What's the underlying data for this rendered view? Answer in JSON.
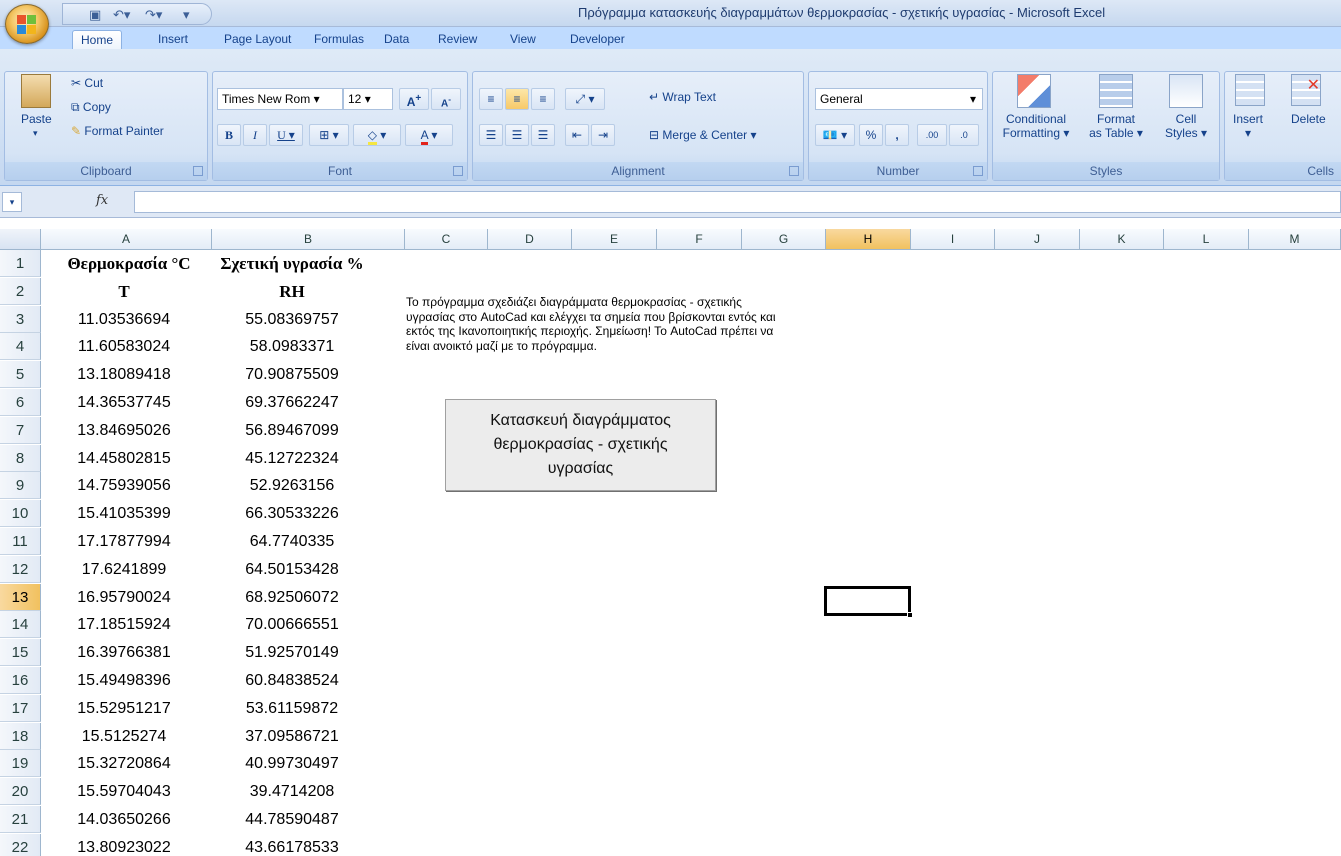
{
  "window": {
    "title": "Πρόγραμμα κατασκευής διαγραμμάτων θερμοκρασίας - σχετικής υγρασίας - Microsoft Excel"
  },
  "tabs": [
    "Home",
    "Insert",
    "Page Layout",
    "Formulas",
    "Data",
    "Review",
    "View",
    "Developer"
  ],
  "ribbon": {
    "clipboard": {
      "label": "Clipboard",
      "paste": "Paste",
      "cut": "Cut",
      "copy": "Copy",
      "format_painter": "Format Painter"
    },
    "font": {
      "label": "Font",
      "font_name": "Times New Rom",
      "font_size": "12"
    },
    "alignment": {
      "label": "Alignment",
      "wrap_text": "Wrap Text",
      "merge_center": "Merge & Center"
    },
    "number": {
      "label": "Number",
      "format": "General",
      "percent": "%",
      "comma": ",",
      "inc_dec": ".00",
      "dec_dec": ".0"
    },
    "styles": {
      "label": "Styles",
      "conditional": "Conditional",
      "conditional2": "Formatting",
      "format_table": "Format",
      "format_table2": "as Table",
      "cell_styles": "Cell",
      "cell_styles2": "Styles"
    },
    "cells": {
      "label": "Cells",
      "insert": "Insert",
      "delete": "Delete"
    }
  },
  "formula_bar": {
    "fx": "fx",
    "value": ""
  },
  "columns": [
    "A",
    "B",
    "C",
    "D",
    "E",
    "F",
    "G",
    "H",
    "I",
    "J",
    "K",
    "L",
    "M"
  ],
  "selected_column": "H",
  "selected_row": "13",
  "sheet": {
    "header_row1": {
      "A": "Θερμοκρασία °C",
      "B": "Σχετική υγρασία %"
    },
    "header_row2": {
      "A": "T",
      "B": "RH"
    },
    "data": [
      [
        "11.03536694",
        "55.08369757"
      ],
      [
        "11.60583024",
        "58.0983371"
      ],
      [
        "13.18089418",
        "70.90875509"
      ],
      [
        "14.36537745",
        "69.37662247"
      ],
      [
        "13.84695026",
        "56.89467099"
      ],
      [
        "14.45802815",
        "45.12722324"
      ],
      [
        "14.75939056",
        "52.9263156"
      ],
      [
        "15.41035399",
        "66.30533226"
      ],
      [
        "17.17877994",
        "64.7740335"
      ],
      [
        "17.6241899",
        "64.50153428"
      ],
      [
        "16.95790024",
        "68.92506072"
      ],
      [
        "17.18515924",
        "70.00666551"
      ],
      [
        "16.39766381",
        "51.92570149"
      ],
      [
        "15.49498396",
        "60.84838524"
      ],
      [
        "15.52951217",
        "53.61159872"
      ],
      [
        "15.5125274",
        "37.09586721"
      ],
      [
        "15.32720864",
        "40.99730497"
      ],
      [
        "15.59704043",
        "39.4714208"
      ],
      [
        "14.03650266",
        "44.78590487"
      ],
      [
        "13.80923022",
        "43.66178533"
      ]
    ],
    "note": "Το πρόγραμμα σχεδιάζει διαγράμματα θερμοκρασίας - σχετικής υγρασίας στο AutoCad και ελέγχει τα σημεία που βρίσκονται εντός και εκτός της Ικανοποιητικής περιοχής. Σημείωση! Το AutoCad πρέπει να είναι ανοικτό μαζί με το πρόγραμμα.",
    "macro_button": "Κατασκευή διαγράμματος θερμοκρασίας - σχετικής υγρασίας"
  }
}
